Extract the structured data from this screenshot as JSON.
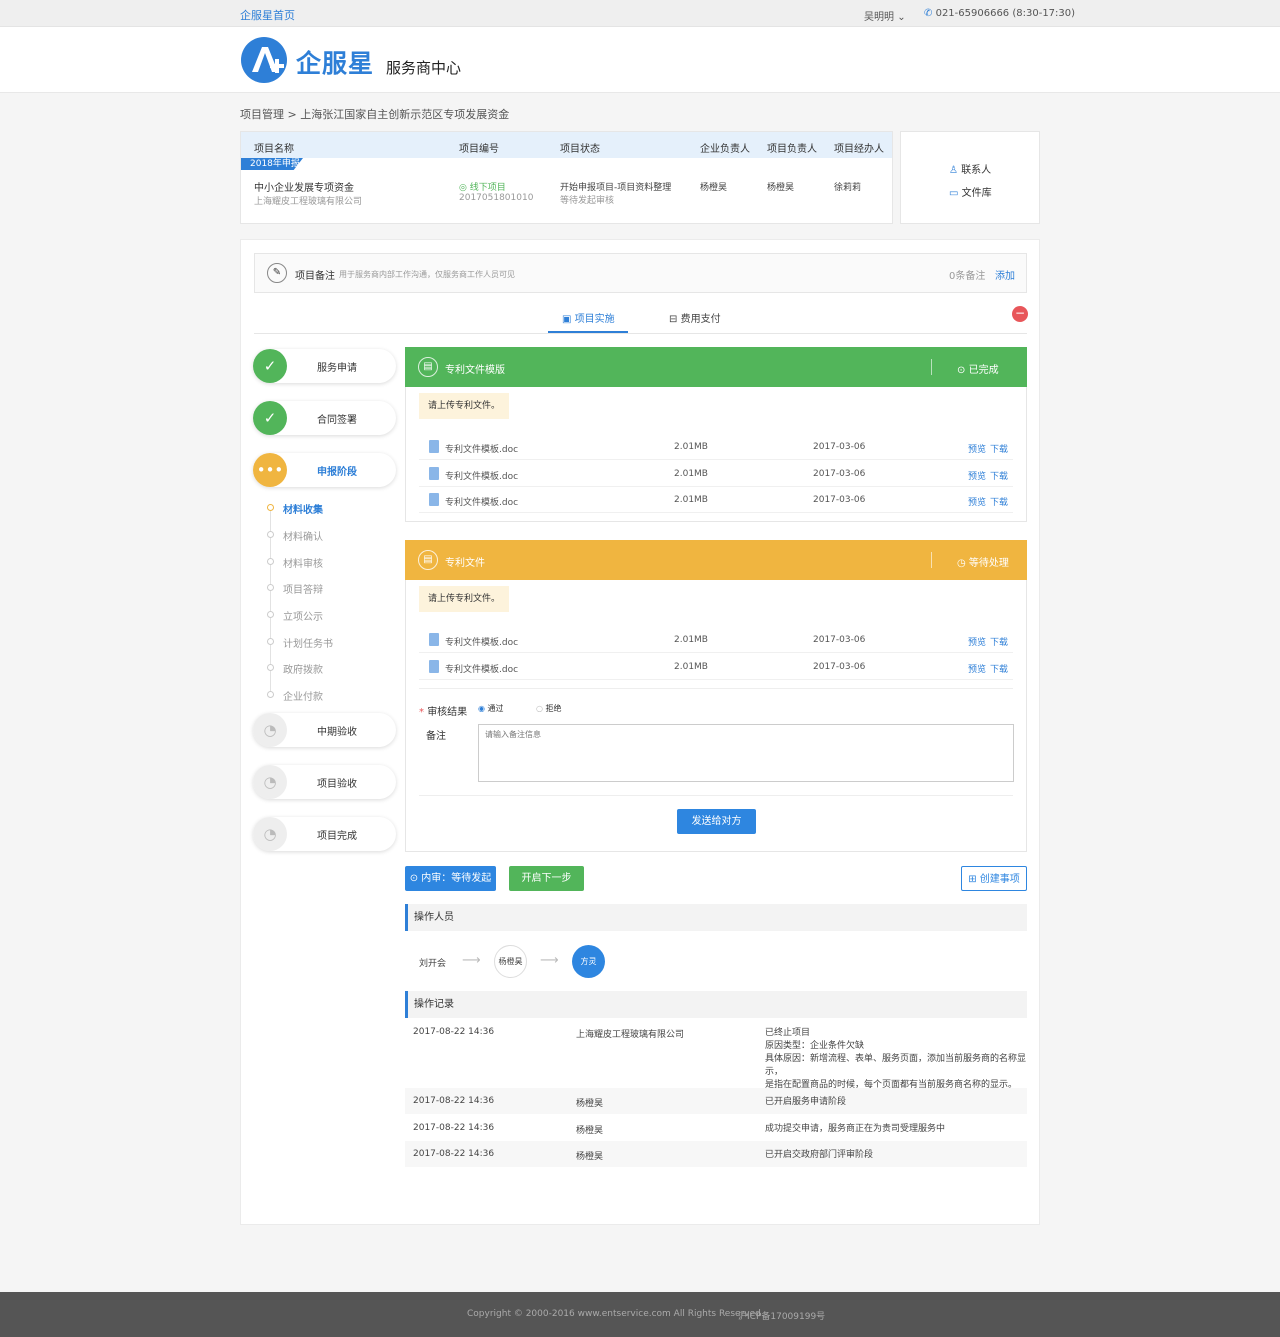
{
  "topbar": {
    "home": "企服星首页",
    "user": "吴明明",
    "phone": "021-65906666 (8:30-17:30)"
  },
  "header": {
    "brand": "企服星",
    "subtitle": "服务商中心"
  },
  "breadcrumb": "项目管理 > 上海张江国家自主创新示范区专项发展资金",
  "project": {
    "headers": [
      "项目名称",
      "项目编号",
      "项目状态",
      "企业负责人",
      "项目负责人",
      "项目经办人"
    ],
    "year_tag": "2018年申报",
    "name": "中小企业发展专项资金",
    "company": "上海耀皮工程玻璃有限公司",
    "type": "线下项目",
    "number": "2017051801010",
    "status": "开始申报项目-项目资料整理",
    "status_sub": "等待发起审核",
    "enterprise_lead": "杨橙昊",
    "project_lead": "杨橙昊",
    "handler": "徐莉莉"
  },
  "side_links": {
    "contacts": "联系人",
    "files": "文件库"
  },
  "note": {
    "title": "项目备注",
    "desc": "用于服务商内部工作沟通，仅服务商工作人员可见",
    "count": "0条备注",
    "add": "添加"
  },
  "tabs": {
    "implement": "项目实施",
    "payment": "费用支付"
  },
  "steps": {
    "s1": "服务申请",
    "s2": "合同签署",
    "s3": "申报阶段",
    "s4": "中期验收",
    "s5": "项目验收",
    "s6": "项目完成",
    "sub": [
      "材料收集",
      "材料确认",
      "材料审核",
      "项目答辩",
      "立项公示",
      "计划任务书",
      "政府拨款",
      "企业付款"
    ]
  },
  "panel1": {
    "title": "专利文件模版",
    "status": "已完成",
    "hint": "请上传专利文件。",
    "files": [
      {
        "name": "专利文件模板.doc",
        "size": "2.01MB",
        "date": "2017-03-06"
      },
      {
        "name": "专利文件模板.doc",
        "size": "2.01MB",
        "date": "2017-03-06"
      },
      {
        "name": "专利文件模板.doc",
        "size": "2.01MB",
        "date": "2017-03-06"
      }
    ]
  },
  "panel2": {
    "title": "专利文件",
    "status": "等待处理",
    "hint": "请上传专利文件。",
    "files": [
      {
        "name": "专利文件模板.doc",
        "size": "2.01MB",
        "date": "2017-03-06"
      },
      {
        "name": "专利文件模板.doc",
        "size": "2.01MB",
        "date": "2017-03-06"
      }
    ],
    "review_label": "审核结果",
    "pass": "通过",
    "reject": "拒绝",
    "remark_label": "备注",
    "remark_placeholder": "请输入备注信息",
    "send": "发送给对方"
  },
  "file_actions": {
    "preview": "预览",
    "download": "下载"
  },
  "actions": {
    "review": "内审：等待发起",
    "next": "开启下一步",
    "create": "创建事项"
  },
  "operators": {
    "title": "操作人员",
    "p1": "刘开会",
    "p2": "杨橙昊",
    "p3": "方灵"
  },
  "records": {
    "title": "操作记录",
    "rows": [
      {
        "time": "2017-08-22 14:36",
        "who": "上海耀皮工程玻璃有限公司",
        "lines": [
          "已终止项目",
          "原因类型：企业条件欠缺",
          "具体原因：新增流程、表单、服务页面，添加当前服务商的名称显示，",
          "是指在配置商品的时候，每个页面都有当前服务商名称的显示。"
        ]
      },
      {
        "time": "2017-08-22 14:36",
        "who": "杨橙昊",
        "lines": [
          "已开启服务申请阶段"
        ]
      },
      {
        "time": "2017-08-22 14:36",
        "who": "杨橙昊",
        "lines": [
          "成功提交申请，服务商正在为贵司受理服务中"
        ]
      },
      {
        "time": "2017-08-22 14:36",
        "who": "杨橙昊",
        "lines": [
          "已开启交政府部门评审阶段"
        ]
      }
    ]
  },
  "footer": {
    "copyright": "Copyright © 2000-2016 www.entservice.com All Rights Reserved",
    "icp": "沪ICP备17009199号"
  },
  "colors": {
    "brand": "#2e7fd7",
    "done": "#52b55a",
    "pending": "#f0b540",
    "danger": "#e8565a"
  }
}
